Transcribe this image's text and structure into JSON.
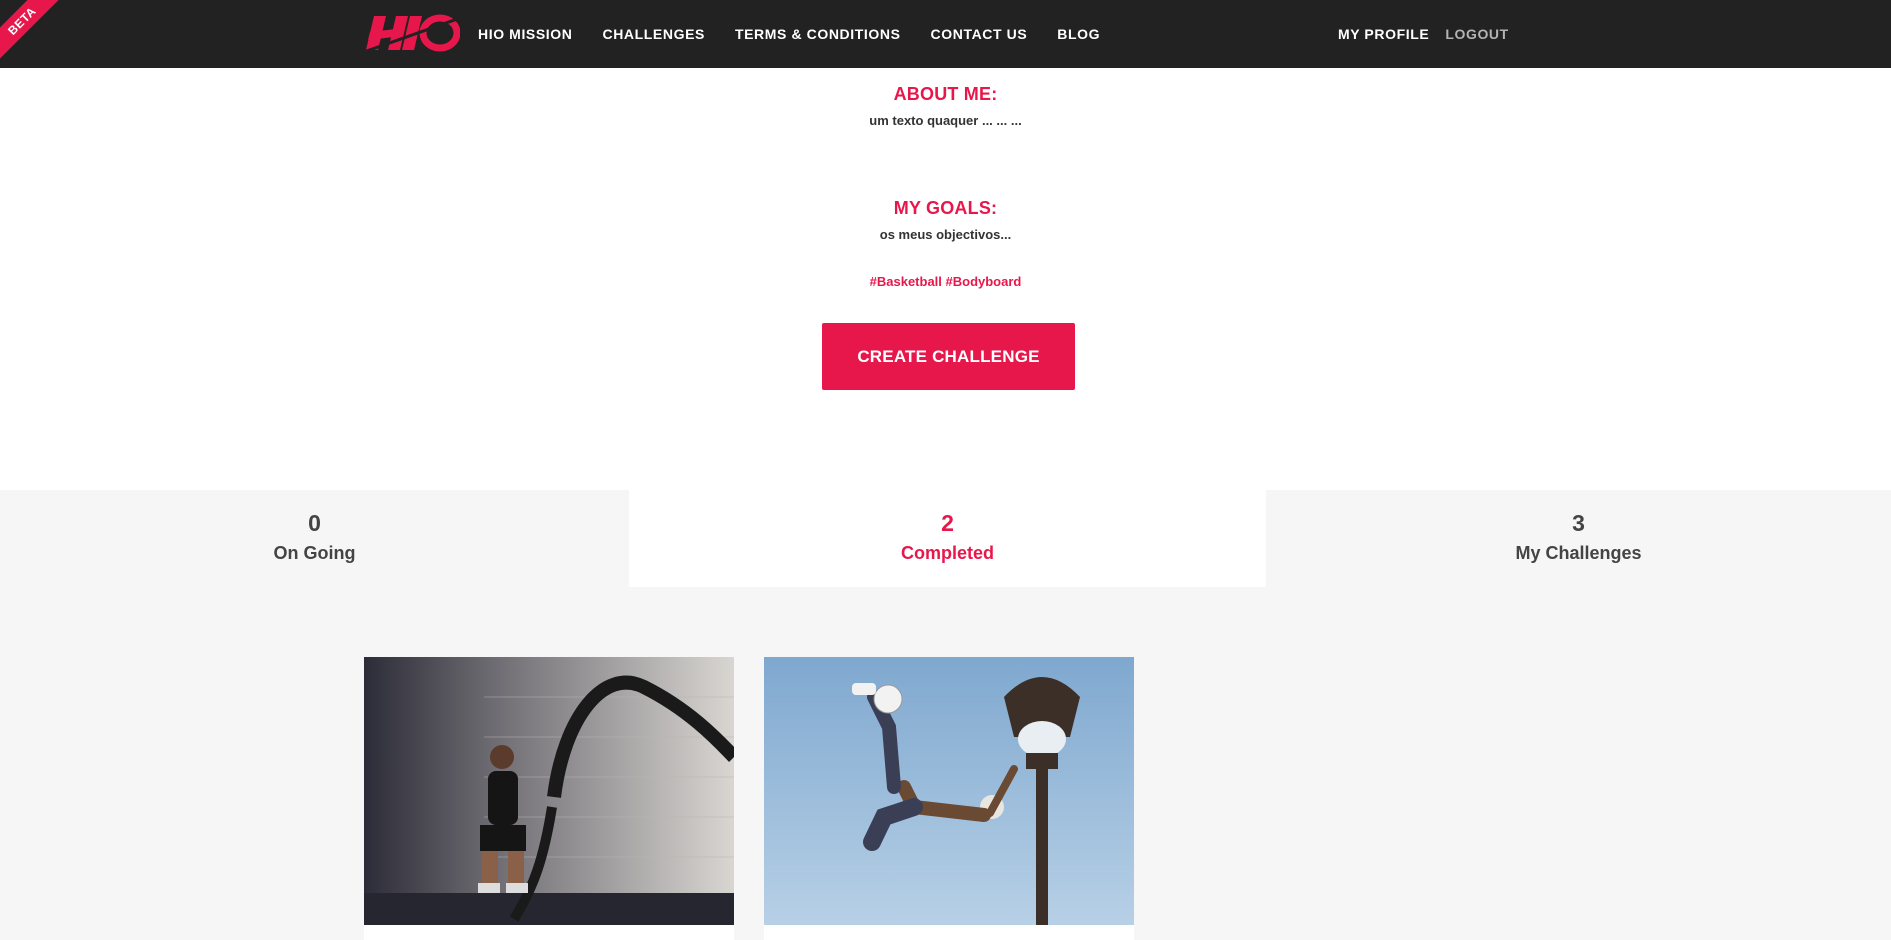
{
  "header": {
    "badge": "BETA",
    "logo_text": "HIO",
    "nav": [
      {
        "label": "HIO MISSION"
      },
      {
        "label": "CHALLENGES"
      },
      {
        "label": "TERMS & CONDITIONS"
      },
      {
        "label": "CONTACT US"
      },
      {
        "label": "BLOG"
      }
    ],
    "my_profile": "MY PROFILE",
    "logout": "LOGOUT"
  },
  "profile": {
    "about_title": "ABOUT ME:",
    "about_text": "um texto quaquer ... ... ...",
    "goals_title": "MY GOALS:",
    "goals_text": "os meus objectivos...",
    "tags": "#Basketball #Bodyboard",
    "create_button": "CREATE CHALLENGE"
  },
  "stats": [
    {
      "count": "0",
      "label": "On Going",
      "active": false
    },
    {
      "count": "2",
      "label": "Completed",
      "active": true
    },
    {
      "count": "3",
      "label": "My Challenges",
      "active": false
    }
  ],
  "cards": [
    {
      "image": "battle-ropes-workout-photo"
    },
    {
      "image": "freestyle-football-lamp-post-photo"
    }
  ],
  "colors": {
    "accent": "#e8174b",
    "header_bg": "#222222",
    "section_bg": "#f6f6f6"
  }
}
